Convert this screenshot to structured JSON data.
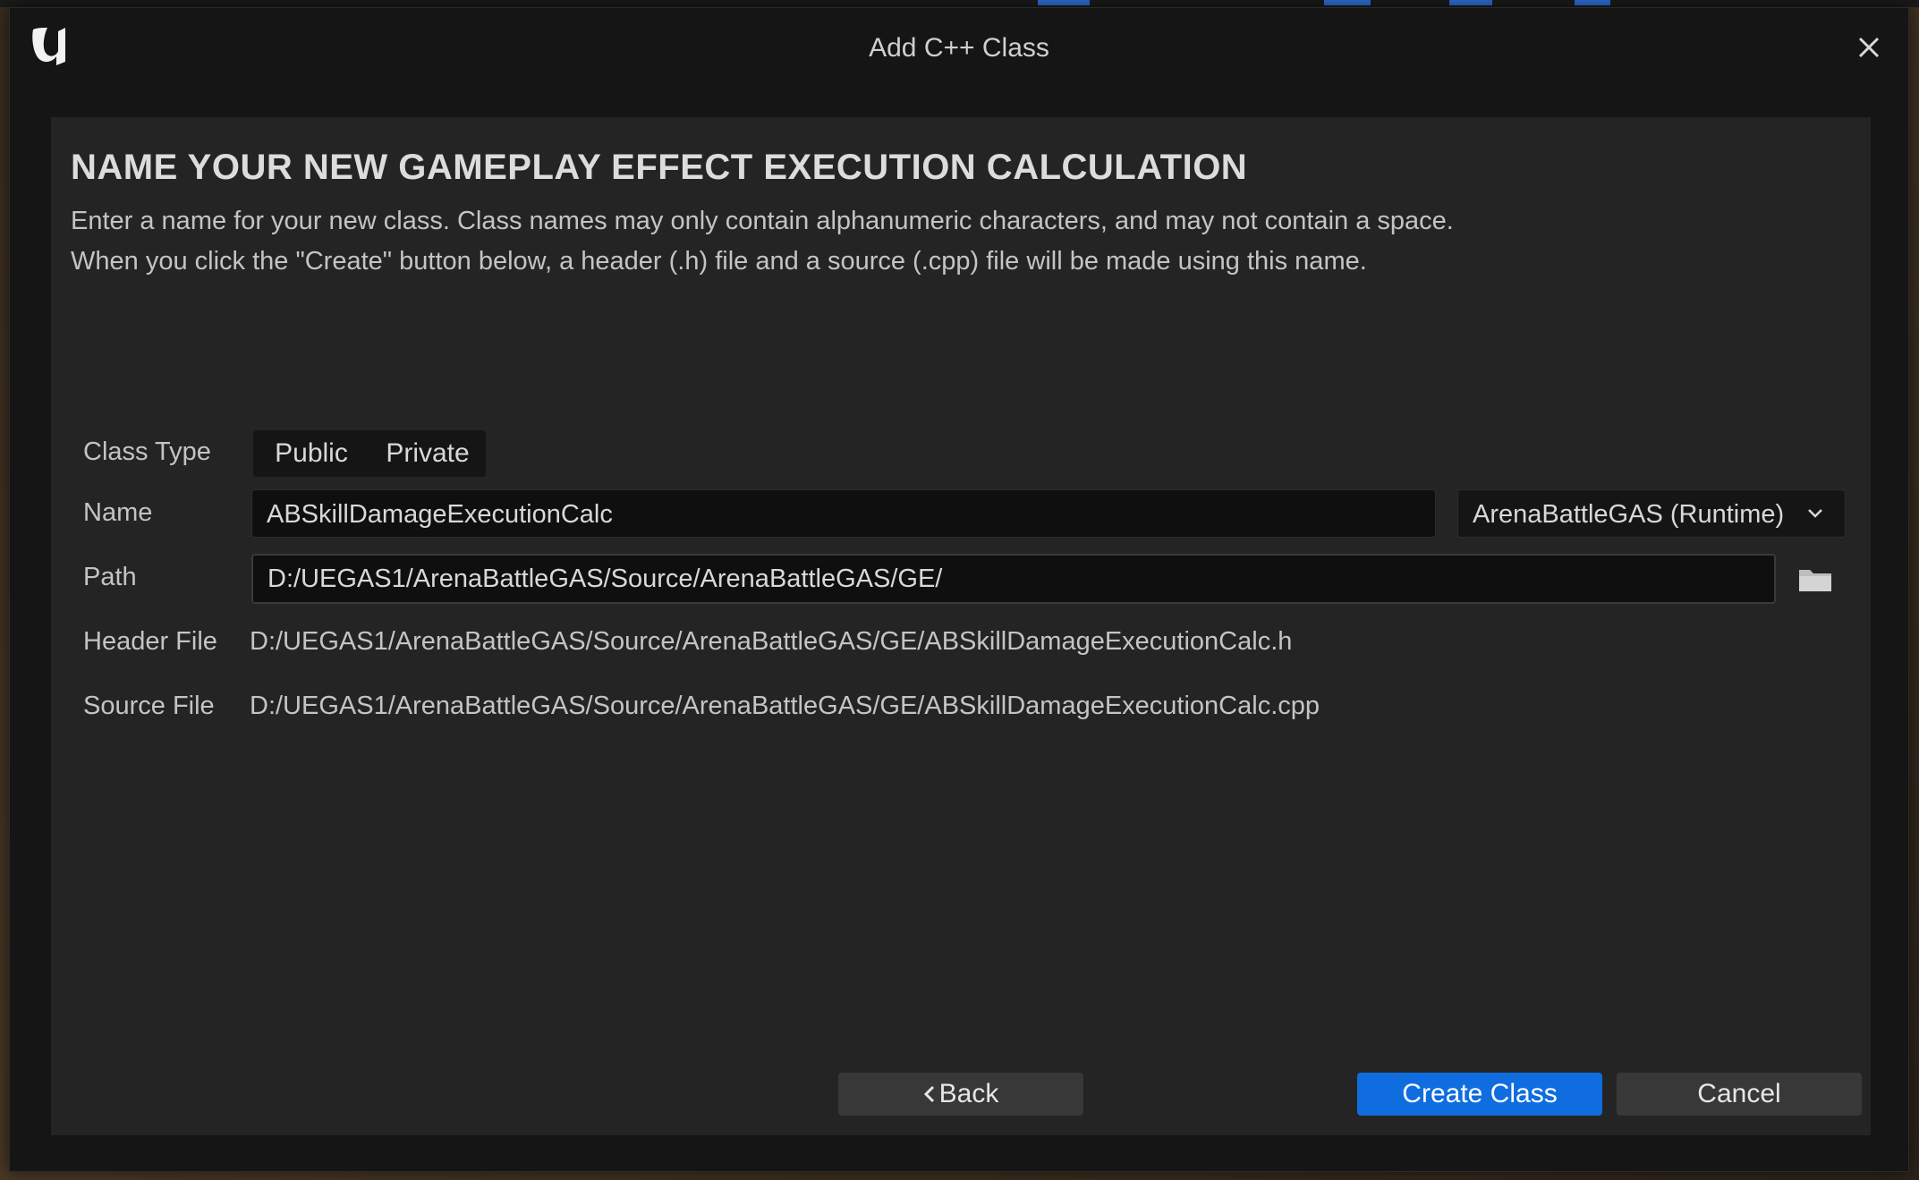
{
  "window": {
    "title": "Add C++ Class"
  },
  "heading": "NAME YOUR NEW GAMEPLAY EFFECT EXECUTION CALCULATION",
  "description": {
    "line1": "Enter a name for your new class. Class names may only contain alphanumeric characters, and may not contain a space.",
    "line2": "When you click the \"Create\" button below, a header (.h) file and a source (.cpp) file will be made using this name."
  },
  "form": {
    "class_type_label": "Class Type",
    "class_type_options": [
      "Public",
      "Private"
    ],
    "name_label": "Name",
    "name_value": "ABSkillDamageExecutionCalc",
    "module_value": "ArenaBattleGAS (Runtime)",
    "path_label": "Path",
    "path_value": "D:/UEGAS1/ArenaBattleGAS/Source/ArenaBattleGAS/GE/",
    "header_label": "Header File",
    "header_value": "D:/UEGAS1/ArenaBattleGAS/Source/ArenaBattleGAS/GE/ABSkillDamageExecutionCalc.h",
    "source_label": "Source File",
    "source_value": "D:/UEGAS1/ArenaBattleGAS/Source/ArenaBattleGAS/GE/ABSkillDamageExecutionCalc.cpp"
  },
  "buttons": {
    "back": "Back",
    "create": "Create Class",
    "cancel": "Cancel"
  },
  "icons": {
    "logo": "unreal-engine-logo",
    "close": "close-icon",
    "chevron": "chevron-down-icon",
    "folder": "folder-icon",
    "back_arrow": "chevron-left-icon"
  },
  "colors": {
    "accent": "#0f6de0",
    "panel": "#242424",
    "window": "#151515"
  }
}
